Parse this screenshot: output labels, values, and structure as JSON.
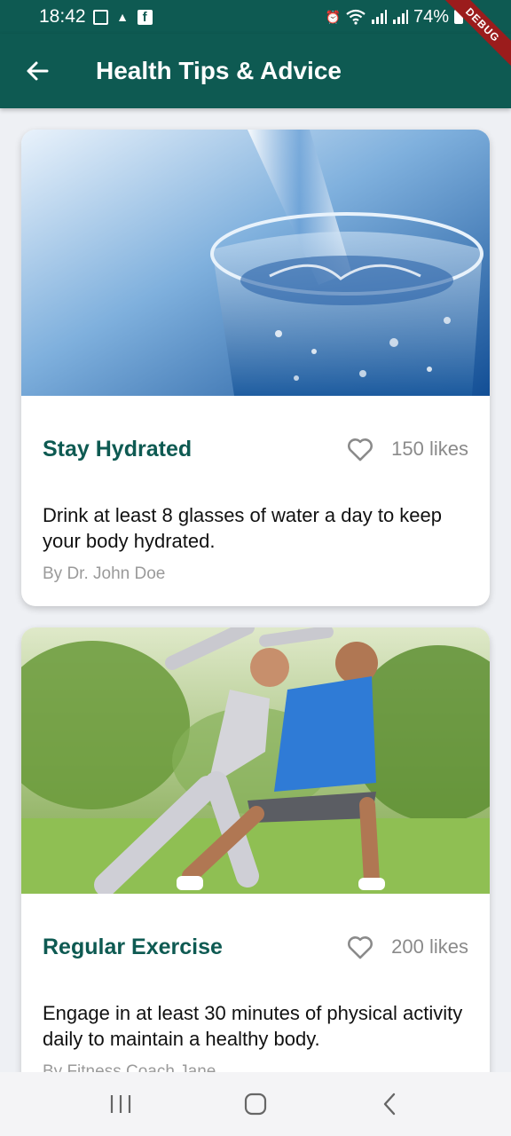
{
  "status_bar": {
    "time": "18:42",
    "battery": "74%",
    "icons": [
      "image-icon",
      "upload-icon",
      "facebook-icon",
      "alarm-icon",
      "wifi-icon",
      "signal-icon",
      "signal-icon",
      "battery-icon"
    ]
  },
  "debug_banner": "DEBUG",
  "app_bar": {
    "title": "Health Tips & Advice",
    "back_icon": "arrow-left-icon"
  },
  "tips": [
    {
      "title": "Stay Hydrated",
      "likes": "150 likes",
      "description": "Drink at least 8 glasses of water a day to keep your body hydrated.",
      "author": "By Dr. John Doe",
      "image": "water-glass-photo"
    },
    {
      "title": "Regular Exercise",
      "likes": "200 likes",
      "description": "Engage in at least 30 minutes of physical activity daily to maintain a healthy body.",
      "author": "By Fitness Coach Jane",
      "image": "exercise-photo"
    }
  ],
  "colors": {
    "primary": "#0e5a52",
    "title_text": "#0e5a52",
    "muted_text": "#8a8a8a",
    "background": "#eef0f4"
  },
  "nav_bar": {
    "icons": [
      "recent-apps-icon",
      "home-icon",
      "back-icon"
    ]
  }
}
